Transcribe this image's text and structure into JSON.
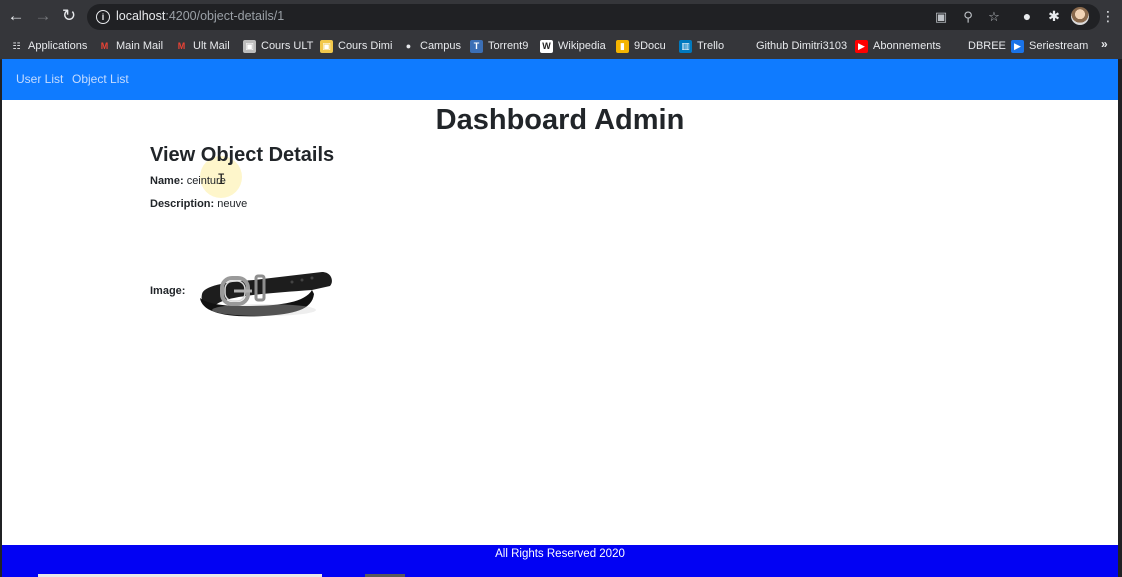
{
  "browser": {
    "url_host": "localhost",
    "url_rest": ":4200/object-details/1",
    "bookmarks": [
      {
        "label": "Applications",
        "icon": "apps-grid-icon",
        "color": "#e8eaed"
      },
      {
        "label": "Main Mail",
        "icon": "gmail-icon",
        "color": "#ea4335"
      },
      {
        "label": "Ult Mail",
        "icon": "gmail-icon",
        "color": "#ea4335"
      },
      {
        "label": "Cours ULT",
        "icon": "classroom-icon",
        "color": "#bdbdbd"
      },
      {
        "label": "Cours Dimi",
        "icon": "classroom-icon",
        "color": "#f2c84b"
      },
      {
        "label": "Campus",
        "icon": "globe-icon",
        "color": "#e8eaed"
      },
      {
        "label": "Torrent9",
        "icon": "torrent9-icon",
        "color": "#3b6fb6"
      },
      {
        "label": "Wikipedia",
        "icon": "wikipedia-icon",
        "color": "#ffffff"
      },
      {
        "label": "9Docu",
        "icon": "9docu-icon",
        "color": "#f4b400"
      },
      {
        "label": "Trello",
        "icon": "trello-icon",
        "color": "#0079bf"
      },
      {
        "label": "Github Dimitri3103",
        "icon": "github-icon",
        "color": "#35363a"
      },
      {
        "label": "Abonnements",
        "icon": "youtube-icon",
        "color": "#ff0000"
      },
      {
        "label": "DBREE",
        "icon": "dbree-icon",
        "color": "#35363a"
      },
      {
        "label": "Seriestream",
        "icon": "play-icon",
        "color": "#1a73e8"
      }
    ],
    "more_label": "»"
  },
  "page": {
    "nav": {
      "user_list": "User List",
      "object_list": "Object List"
    },
    "title": "Dashboard Admin",
    "section_title": "View Object Details",
    "name_label": "Name:",
    "name_value": "ceinture",
    "description_label": "Description:",
    "description_value": "neuve",
    "image_label": "Image:",
    "footer": "All Rights Reserved 2020"
  },
  "colors": {
    "navbar": "#0f7bff",
    "footer": "#0202f3"
  }
}
